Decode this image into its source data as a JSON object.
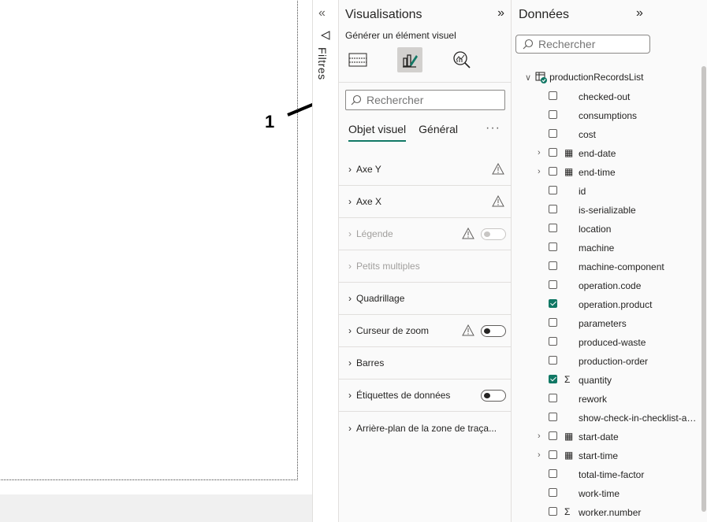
{
  "annotation": {
    "label": "1"
  },
  "filters": {
    "label": "Filtres"
  },
  "visualisations": {
    "title": "Visualisations",
    "subtitle": "Générer un élément visuel",
    "search_placeholder": "Rechercher",
    "tabs": [
      {
        "label": "Objet visuel",
        "active": true
      },
      {
        "label": "Général",
        "active": false
      }
    ],
    "more": "···",
    "sections": [
      {
        "label": "Axe Y",
        "warning": true,
        "toggle": null,
        "disabled": false
      },
      {
        "label": "Axe X",
        "warning": true,
        "toggle": null,
        "disabled": false
      },
      {
        "label": "Légende",
        "warning": true,
        "toggle": "off",
        "disabled": true
      },
      {
        "label": "Petits multiples",
        "warning": false,
        "toggle": null,
        "disabled": true
      },
      {
        "label": "Quadrillage",
        "warning": false,
        "toggle": null,
        "disabled": false
      },
      {
        "label": "Curseur de zoom",
        "warning": true,
        "toggle": "off",
        "disabled": false
      },
      {
        "label": "Barres",
        "warning": false,
        "toggle": null,
        "disabled": false
      },
      {
        "label": "Étiquettes de données",
        "warning": false,
        "toggle": "off",
        "disabled": false
      },
      {
        "label": "Arrière-plan de la zone de traça...",
        "warning": false,
        "toggle": null,
        "disabled": false
      }
    ]
  },
  "data": {
    "title": "Données",
    "search_placeholder": "Rechercher",
    "table": "productionRecordsList",
    "fields": [
      {
        "name": "checked-out",
        "checked": false,
        "icon": "",
        "expandable": false
      },
      {
        "name": "consumptions",
        "checked": false,
        "icon": "",
        "expandable": false
      },
      {
        "name": "cost",
        "checked": false,
        "icon": "",
        "expandable": false
      },
      {
        "name": "end-date",
        "checked": false,
        "icon": "calendar-icon",
        "expandable": true
      },
      {
        "name": "end-time",
        "checked": false,
        "icon": "calendar-icon",
        "expandable": true
      },
      {
        "name": "id",
        "checked": false,
        "icon": "",
        "expandable": false
      },
      {
        "name": "is-serializable",
        "checked": false,
        "icon": "",
        "expandable": false
      },
      {
        "name": "location",
        "checked": false,
        "icon": "",
        "expandable": false
      },
      {
        "name": "machine",
        "checked": false,
        "icon": "",
        "expandable": false
      },
      {
        "name": "machine-component",
        "checked": false,
        "icon": "",
        "expandable": false
      },
      {
        "name": "operation.code",
        "checked": false,
        "icon": "",
        "expandable": false
      },
      {
        "name": "operation.product",
        "checked": true,
        "icon": "",
        "expandable": false
      },
      {
        "name": "parameters",
        "checked": false,
        "icon": "",
        "expandable": false
      },
      {
        "name": "produced-waste",
        "checked": false,
        "icon": "",
        "expandable": false
      },
      {
        "name": "production-order",
        "checked": false,
        "icon": "",
        "expandable": false
      },
      {
        "name": "quantity",
        "checked": true,
        "icon": "sigma-icon",
        "expandable": false
      },
      {
        "name": "rework",
        "checked": false,
        "icon": "",
        "expandable": false
      },
      {
        "name": "show-check-in-checklist-an...",
        "checked": false,
        "icon": "",
        "expandable": false
      },
      {
        "name": "start-date",
        "checked": false,
        "icon": "calendar-icon",
        "expandable": true
      },
      {
        "name": "start-time",
        "checked": false,
        "icon": "calendar-icon",
        "expandable": true
      },
      {
        "name": "total-time-factor",
        "checked": false,
        "icon": "",
        "expandable": false
      },
      {
        "name": "work-time",
        "checked": false,
        "icon": "",
        "expandable": false
      },
      {
        "name": "worker.number",
        "checked": false,
        "icon": "sigma-icon",
        "expandable": false
      }
    ]
  },
  "colors": {
    "accent": "#117865",
    "annotation": "#000000"
  }
}
